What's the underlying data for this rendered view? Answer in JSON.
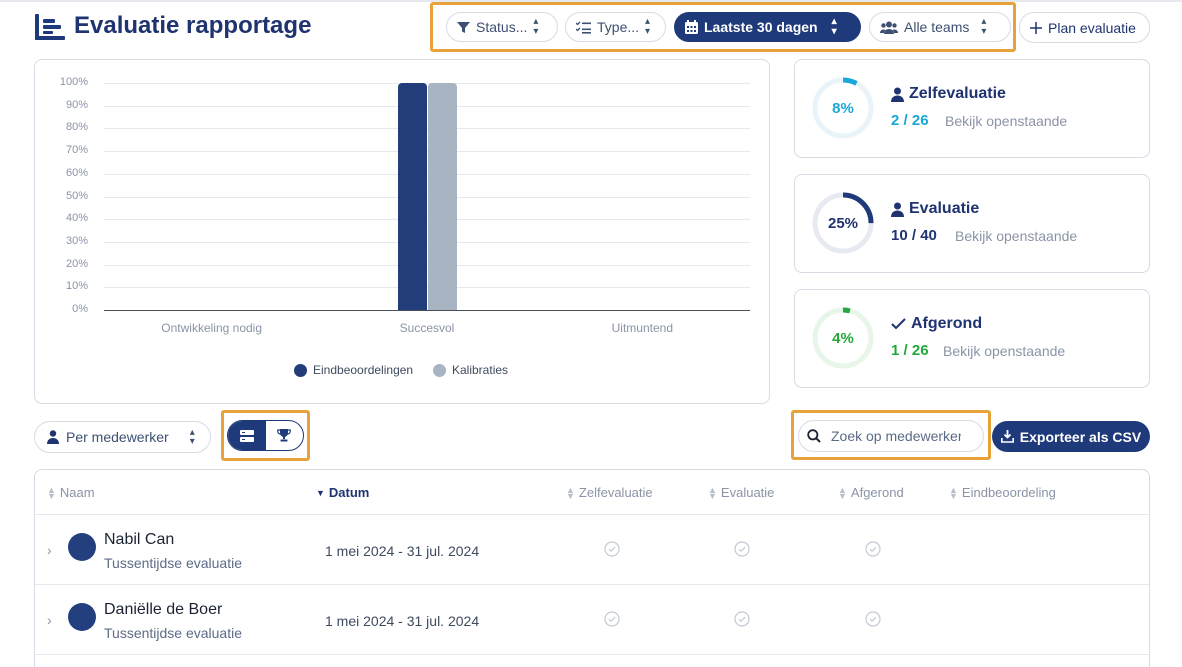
{
  "header": {
    "title": "Evaluatie rapportage",
    "filters": {
      "status": "Status...",
      "type": "Type...",
      "period": "Laatste 30 dagen",
      "teams": "Alle teams"
    },
    "plan_button": "Plan evaluatie"
  },
  "chart_data": {
    "type": "bar",
    "categories": [
      "Ontwikkeling nodig",
      "Succesvol",
      "Uitmuntend"
    ],
    "series": [
      {
        "name": "Eindbeoordelingen",
        "values": [
          0,
          100,
          0
        ],
        "color": "#223d7a"
      },
      {
        "name": "Kalibraties",
        "values": [
          0,
          100,
          0
        ],
        "color": "#a8b4c2"
      }
    ],
    "yticks": [
      "0%",
      "10%",
      "20%",
      "30%",
      "40%",
      "50%",
      "60%",
      "70%",
      "80%",
      "90%",
      "100%"
    ],
    "ylim": [
      0,
      100
    ],
    "legend_position": "bottom-center",
    "grid": true
  },
  "stats": [
    {
      "percent_label": "8%",
      "percent": 8,
      "title": "Zelfevaluatie",
      "done": "2",
      "total": "26",
      "link": "Bekijk openstaande",
      "color": "#1ba8d8",
      "icon": "user-icon"
    },
    {
      "percent_label": "25%",
      "percent": 25,
      "title": "Evaluatie",
      "done": "10",
      "total": "40",
      "link": "Bekijk openstaande",
      "color": "#1f3a7a",
      "icon": "user-icon"
    },
    {
      "percent_label": "4%",
      "percent": 4,
      "title": "Afgerond",
      "done": "1",
      "total": "26",
      "link": "Bekijk openstaande",
      "color": "#22a83a",
      "icon": "check-icon"
    }
  ],
  "toolbar": {
    "group_by": "Per medewerker",
    "search_placeholder": "Zoek op medewerker",
    "export_label": "Exporteer als CSV"
  },
  "table": {
    "columns": [
      "Naam",
      "Datum",
      "Zelfevaluatie",
      "Evaluatie",
      "Afgerond",
      "Eindbeoordeling"
    ],
    "rows": [
      {
        "name": "Nabil Can",
        "subtitle": "Tussentijdse evaluatie",
        "date": "1 mei 2024 - 31 jul. 2024"
      },
      {
        "name": "Daniëlle de Boer",
        "subtitle": "Tussentijdse evaluatie",
        "date": "1 mei 2024 - 31 jul. 2024"
      }
    ]
  }
}
